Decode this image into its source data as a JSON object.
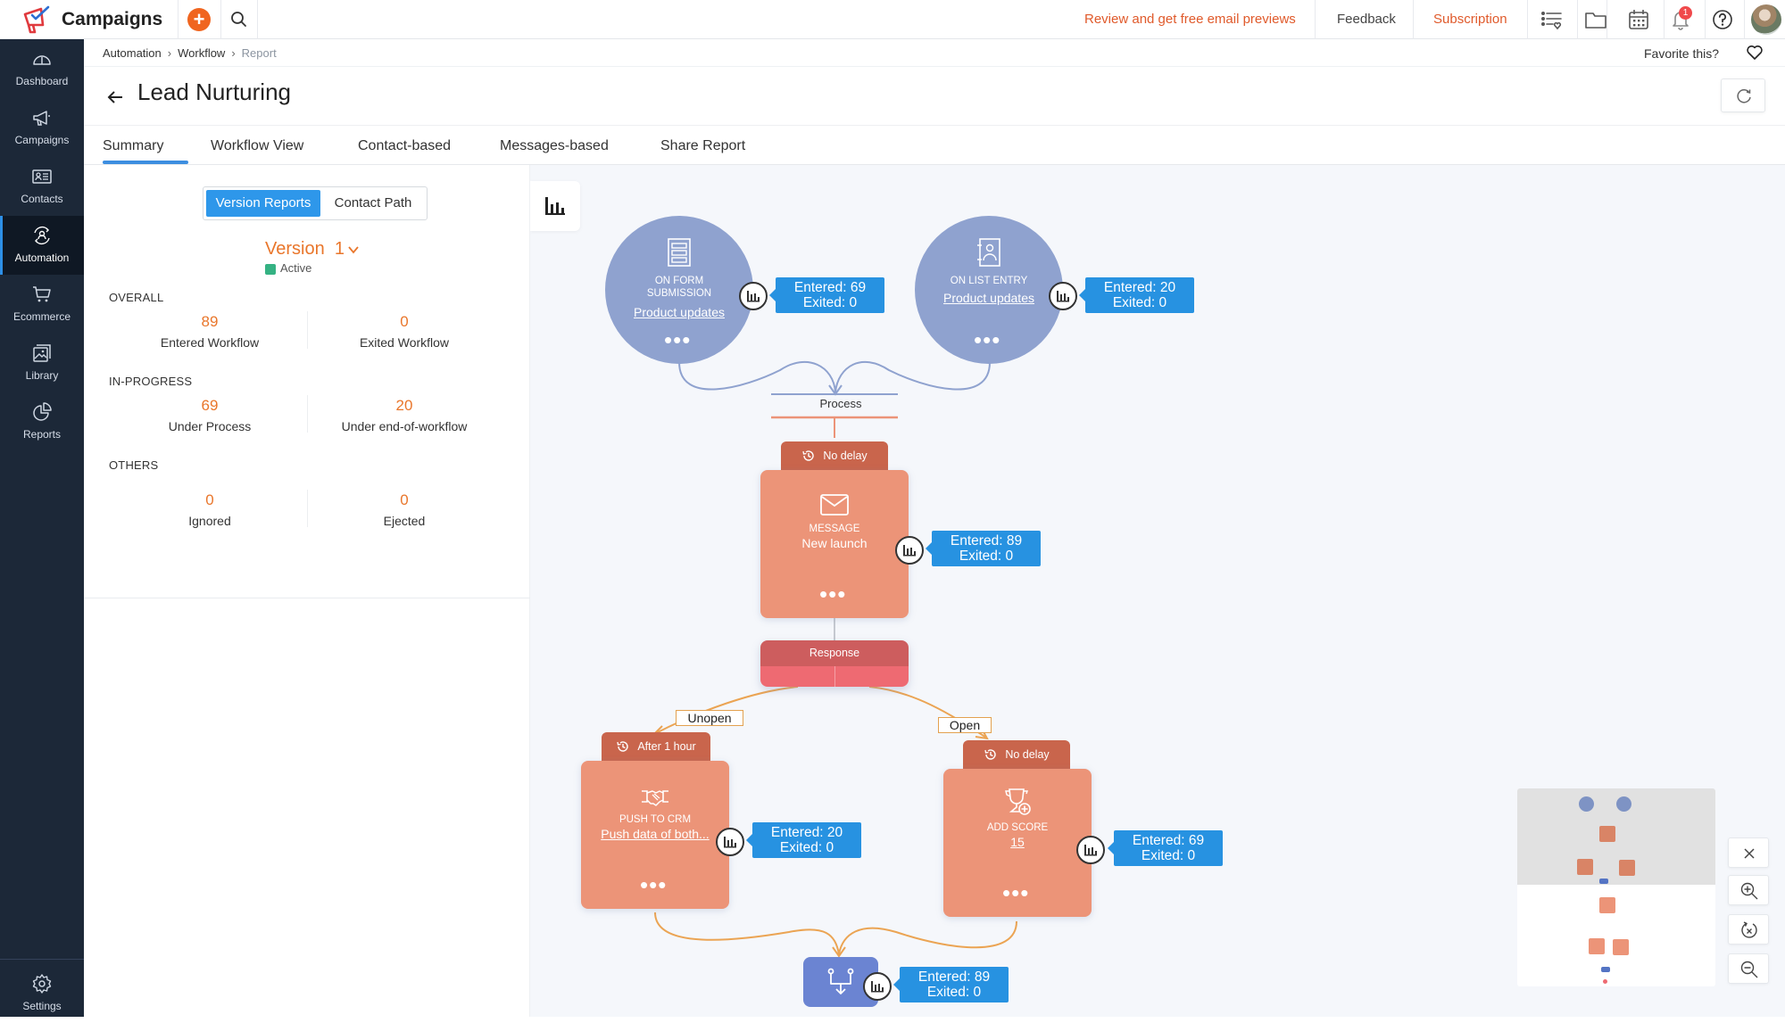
{
  "app": {
    "name": "Campaigns",
    "brand_color": "#e03a3e",
    "accent_color": "#f0651f"
  },
  "topbar": {
    "create_icon": "plus-icon",
    "search_icon": "search-icon",
    "promo_link": "Review and get free email previews",
    "feedback_label": "Feedback",
    "subscription_label": "Subscription",
    "icons": [
      "task-list-icon",
      "folder-icon",
      "calendar-icon",
      "bell-icon",
      "help-icon",
      "avatar"
    ],
    "notification_count": "1"
  },
  "sidebar": {
    "items": [
      {
        "label": "Dashboard",
        "icon": "dashboard-icon",
        "active": false
      },
      {
        "label": "Campaigns",
        "icon": "megaphone-icon",
        "active": false
      },
      {
        "label": "Contacts",
        "icon": "contact-card-icon",
        "active": false
      },
      {
        "label": "Automation",
        "icon": "automation-icon",
        "active": true
      },
      {
        "label": "Ecommerce",
        "icon": "cart-icon",
        "active": false
      },
      {
        "label": "Library",
        "icon": "image-library-icon",
        "active": false
      },
      {
        "label": "Reports",
        "icon": "pie-chart-icon",
        "active": false
      }
    ],
    "settings_label": "Settings"
  },
  "breadcrumb": {
    "items": [
      "Automation",
      "Workflow",
      "Report"
    ]
  },
  "header": {
    "title": "Lead Nurturing",
    "favorite_label": "Favorite this?"
  },
  "tabs": [
    {
      "label": "Summary",
      "active": true
    },
    {
      "label": "Workflow View",
      "active": false
    },
    {
      "label": "Contact-based",
      "active": false
    },
    {
      "label": "Messages-based",
      "active": false
    },
    {
      "label": "Share Report",
      "active": false
    }
  ],
  "summary": {
    "segments": {
      "selected": "Version Reports",
      "other": "Contact Path"
    },
    "version_label": "Version",
    "version_number": "1",
    "status": "Active",
    "status_color": "#35b283",
    "sections": [
      {
        "title": "OVERALL",
        "stats": [
          {
            "value": "89",
            "label": "Entered Workflow"
          },
          {
            "value": "0",
            "label": "Exited Workflow"
          }
        ]
      },
      {
        "title": "IN-PROGRESS",
        "stats": [
          {
            "value": "69",
            "label": "Under Process"
          },
          {
            "value": "20",
            "label": "Under end-of-workflow"
          }
        ]
      },
      {
        "title": "OTHERS",
        "stats": [
          {
            "value": "0",
            "label": "Ignored"
          },
          {
            "value": "0",
            "label": "Ejected"
          }
        ]
      }
    ]
  },
  "workflow": {
    "triggers": [
      {
        "type_line1": "ON FORM",
        "type_line2": "SUBMISSION",
        "name": "Product updates",
        "entered": "Entered: 69",
        "exited": "Exited: 0"
      },
      {
        "type_line1": "ON LIST ENTRY",
        "type_line2": "",
        "name": "Product updates",
        "entered": "Entered: 20",
        "exited": "Exited: 0"
      }
    ],
    "process_label": "Process",
    "message": {
      "delay": "No delay",
      "type": "MESSAGE",
      "name": "New launch",
      "entered": "Entered: 89",
      "exited": "Exited: 0"
    },
    "response_label": "Response",
    "branches": {
      "left": "Unopen",
      "right": "Open"
    },
    "crm": {
      "delay": "After 1 hour",
      "type": "PUSH TO CRM",
      "name": "Push data of both...",
      "entered": "Entered: 20",
      "exited": "Exited: 0"
    },
    "score": {
      "delay": "No delay",
      "type": "ADD SCORE",
      "name": "15",
      "entered": "Entered: 69",
      "exited": "Exited: 0"
    },
    "merge": {
      "entered": "Entered: 89",
      "exited": "Exited: 0"
    },
    "more_glyph": "•••"
  },
  "canvas_controls": [
    "close-icon",
    "zoom-in-icon",
    "reset-zoom-icon",
    "zoom-out-icon"
  ]
}
